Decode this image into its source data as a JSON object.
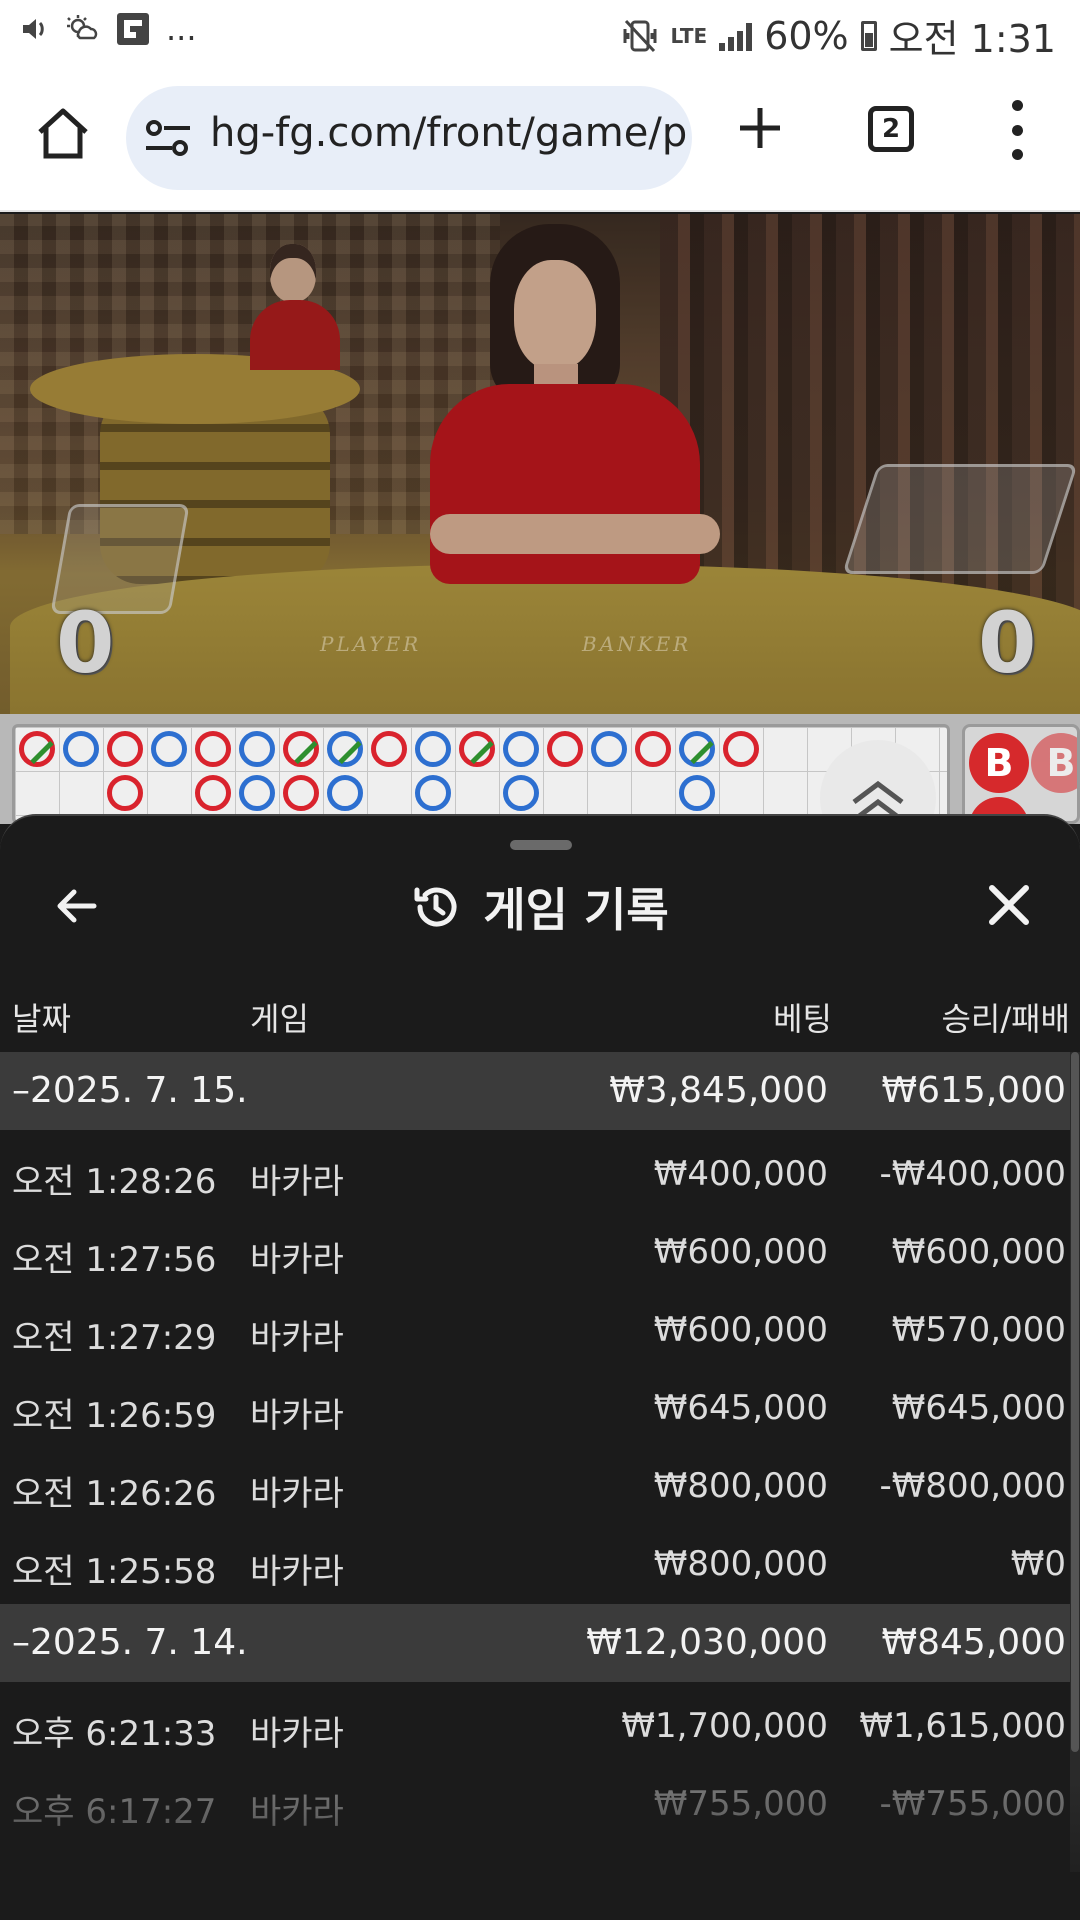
{
  "status_bar": {
    "time": "오전 1:31",
    "battery": "60%",
    "network": "LTE",
    "left_icons": [
      "volume-icon",
      "weather-icon",
      "flipboard-icon"
    ],
    "left_more": "...",
    "right_icons": [
      "mute-icon",
      "lte-icon",
      "signal-icon",
      "battery-icon"
    ]
  },
  "browser": {
    "url": "hg-fg.com/front/game/p",
    "tab_count": "2",
    "icons": [
      "home-icon",
      "site-settings-icon",
      "new-tab-icon",
      "tab-switcher-icon",
      "menu-icon"
    ]
  },
  "video": {
    "player_label": "PLAYER",
    "banker_label": "BANKER",
    "player_score": "0",
    "banker_score": "0"
  },
  "roadmap": {
    "bead_marks": [
      {
        "c": 0,
        "r": 0,
        "color": "red",
        "tie": true
      },
      {
        "c": 1,
        "r": 0,
        "color": "blue"
      },
      {
        "c": 2,
        "r": 0,
        "color": "red"
      },
      {
        "c": 3,
        "r": 0,
        "color": "blue"
      },
      {
        "c": 4,
        "r": 0,
        "color": "red"
      },
      {
        "c": 5,
        "r": 0,
        "color": "blue"
      },
      {
        "c": 6,
        "r": 0,
        "color": "red",
        "tie": true
      },
      {
        "c": 7,
        "r": 0,
        "color": "blue",
        "tie": true
      },
      {
        "c": 8,
        "r": 0,
        "color": "red"
      },
      {
        "c": 9,
        "r": 0,
        "color": "blue"
      },
      {
        "c": 10,
        "r": 0,
        "color": "red",
        "tie": true
      },
      {
        "c": 11,
        "r": 0,
        "color": "blue"
      },
      {
        "c": 12,
        "r": 0,
        "color": "red"
      },
      {
        "c": 13,
        "r": 0,
        "color": "blue"
      },
      {
        "c": 14,
        "r": 0,
        "color": "red"
      },
      {
        "c": 15,
        "r": 0,
        "color": "blue",
        "tie": true
      },
      {
        "c": 16,
        "r": 0,
        "color": "red"
      },
      {
        "c": 2,
        "r": 1,
        "color": "red"
      },
      {
        "c": 4,
        "r": 1,
        "color": "red"
      },
      {
        "c": 5,
        "r": 1,
        "color": "blue"
      },
      {
        "c": 6,
        "r": 1,
        "color": "red"
      },
      {
        "c": 7,
        "r": 1,
        "color": "blue"
      },
      {
        "c": 9,
        "r": 1,
        "color": "blue"
      },
      {
        "c": 11,
        "r": 1,
        "color": "blue"
      },
      {
        "c": 15,
        "r": 1,
        "color": "blue"
      }
    ],
    "big_road_label_1": "B",
    "big_road_label_2": "B",
    "expand_icon": "double-chevron-up-icon"
  },
  "sheet": {
    "title": "게임 기록",
    "icons": [
      "back-arrow-icon",
      "history-icon",
      "close-icon"
    ],
    "columns": {
      "date": "날짜",
      "game": "게임",
      "bet": "베팅",
      "winloss": "승리/패배"
    },
    "groups": [
      {
        "date": "–2025. 7. 15.",
        "bet_total": "₩3,845,000",
        "winloss_total": "₩615,000",
        "rows": [
          {
            "time": "오전 1:28:26",
            "game": "바카라",
            "bet": "₩400,000",
            "winloss": "-₩400,000"
          },
          {
            "time": "오전 1:27:56",
            "game": "바카라",
            "bet": "₩600,000",
            "winloss": "₩600,000"
          },
          {
            "time": "오전 1:27:29",
            "game": "바카라",
            "bet": "₩600,000",
            "winloss": "₩570,000"
          },
          {
            "time": "오전 1:26:59",
            "game": "바카라",
            "bet": "₩645,000",
            "winloss": "₩645,000"
          },
          {
            "time": "오전 1:26:26",
            "game": "바카라",
            "bet": "₩800,000",
            "winloss": "-₩800,000"
          },
          {
            "time": "오전 1:25:58",
            "game": "바카라",
            "bet": "₩800,000",
            "winloss": "₩0"
          }
        ]
      },
      {
        "date": "–2025. 7. 14.",
        "bet_total": "₩12,030,000",
        "winloss_total": "₩845,000",
        "rows": [
          {
            "time": "오후 6:21:33",
            "game": "바카라",
            "bet": "₩1,700,000",
            "winloss": "₩1,615,000"
          },
          {
            "time": "오후 6:17:27",
            "game": "바카라",
            "bet": "₩755,000",
            "winloss": "-₩755,000"
          }
        ]
      }
    ]
  }
}
